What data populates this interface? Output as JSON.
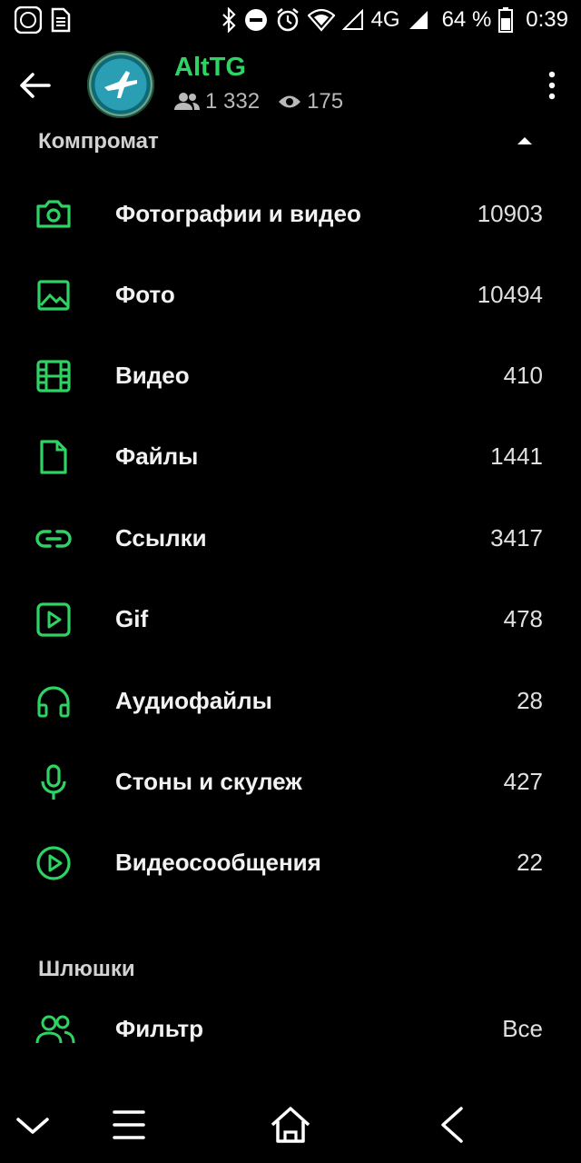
{
  "status_bar": {
    "network": "4G",
    "battery_percent": "64 %",
    "time": "0:39"
  },
  "header": {
    "title": "AltTG",
    "members": "1 332",
    "views": "175"
  },
  "section1": {
    "title": "Компромат",
    "items": [
      {
        "icon": "camera-icon",
        "label": "Фотографии и видео",
        "count": "10903"
      },
      {
        "icon": "image-icon",
        "label": "Фото",
        "count": "10494"
      },
      {
        "icon": "film-icon",
        "label": "Видео",
        "count": "410"
      },
      {
        "icon": "file-icon",
        "label": "Файлы",
        "count": "1441"
      },
      {
        "icon": "link-icon",
        "label": "Ссылки",
        "count": "3417"
      },
      {
        "icon": "gif-play-icon",
        "label": "Gif",
        "count": "478"
      },
      {
        "icon": "headphones-icon",
        "label": "Аудиофайлы",
        "count": "28"
      },
      {
        "icon": "microphone-icon",
        "label": "Стоны и скулеж",
        "count": "427"
      },
      {
        "icon": "video-message-icon",
        "label": "Видеосообщения",
        "count": "22"
      }
    ]
  },
  "section2": {
    "title": "Шлюшки",
    "filter_label": "Фильтр",
    "filter_value": "Все"
  },
  "colors": {
    "accent": "#2fd363",
    "background": "#000000",
    "text": "#f2f2f2"
  }
}
